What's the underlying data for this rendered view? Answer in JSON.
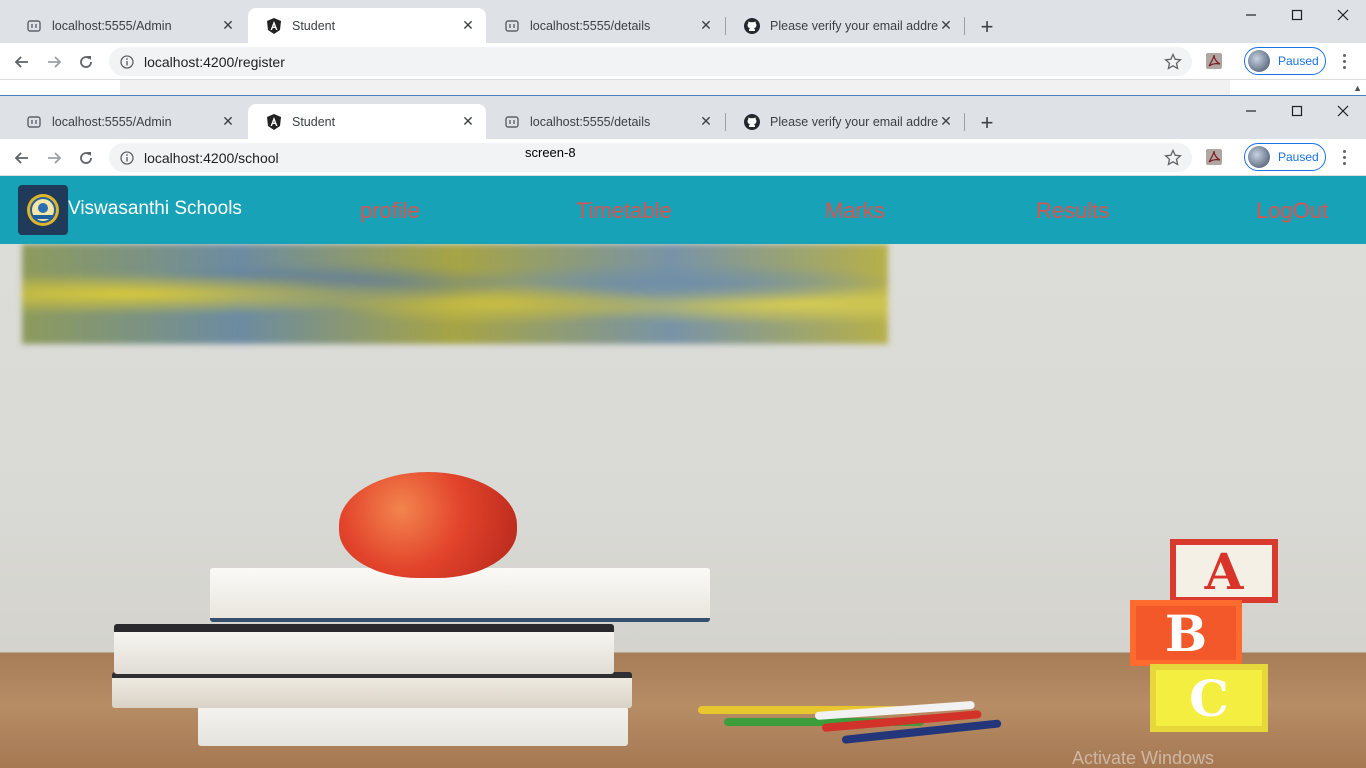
{
  "browsers": [
    {
      "tabs": [
        {
          "title": "localhost:5555/Admin",
          "icon": "page-icon"
        },
        {
          "title": "Student",
          "icon": "angular-icon"
        },
        {
          "title": "localhost:5555/details",
          "icon": "page-icon"
        },
        {
          "title": "Please verify your email address",
          "icon": "github-icon"
        }
      ],
      "url": "localhost:4200/register",
      "profile_status": "Paused"
    },
    {
      "tabs": [
        {
          "title": "localhost:5555/Admin",
          "icon": "page-icon"
        },
        {
          "title": "Student",
          "icon": "angular-icon"
        },
        {
          "title": "localhost:5555/details",
          "icon": "page-icon"
        },
        {
          "title": "Please verify your email address",
          "icon": "github-icon"
        }
      ],
      "url": "localhost:4200/school",
      "profile_status": "Paused"
    }
  ],
  "screen_label": "screen-8",
  "app": {
    "brand": "Viswasanthi Schools",
    "nav": [
      "profile",
      "Timetable",
      "Marks",
      "Results",
      "LogOut"
    ],
    "colors": {
      "navbar": "#17a2b8",
      "nav_link": "#d9534f"
    }
  },
  "hero": {
    "blocks": [
      "A",
      "B",
      "C"
    ],
    "watermark": "Activate Windows"
  }
}
